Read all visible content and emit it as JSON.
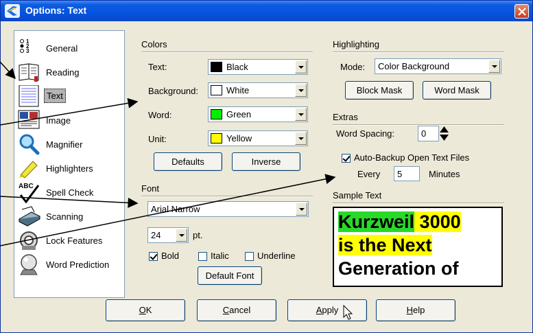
{
  "window": {
    "title": "Options: Text"
  },
  "categories": [
    {
      "label": "General",
      "icon": "general-list-icon"
    },
    {
      "label": "Reading",
      "icon": "reading-book-icon"
    },
    {
      "label": "Text",
      "icon": "text-page-icon",
      "selected": true
    },
    {
      "label": "Image",
      "icon": "image-icon"
    },
    {
      "label": "Magnifier",
      "icon": "magnifier-icon"
    },
    {
      "label": "Highlighters",
      "icon": "highlighter-icon"
    },
    {
      "label": "Spell Check",
      "icon": "spell-check-icon"
    },
    {
      "label": "Scanning",
      "icon": "scanner-icon"
    },
    {
      "label": "Lock Features",
      "icon": "lock-icon"
    },
    {
      "label": "Word Prediction",
      "icon": "crystal-ball-icon"
    }
  ],
  "colors": {
    "header": "Colors",
    "text_label": "Text:",
    "text_value": "Black",
    "text_swatch": "#000000",
    "background_label": "Background:",
    "background_value": "White",
    "background_swatch": "#ffffff",
    "word_label": "Word:",
    "word_value": "Green",
    "word_swatch": "#00ee00",
    "unit_label": "Unit:",
    "unit_value": "Yellow",
    "unit_swatch": "#ffff00",
    "defaults_button": "Defaults",
    "inverse_button": "Inverse"
  },
  "font": {
    "header": "Font",
    "family": "Arial Narrow",
    "size": "24",
    "size_unit": "pt.",
    "bold_label": "Bold",
    "bold_checked": true,
    "italic_label": "Italic",
    "italic_checked": false,
    "underline_label": "Underline",
    "underline_checked": false,
    "default_button": "Default Font"
  },
  "highlighting": {
    "header": "Highlighting",
    "mode_label": "Mode:",
    "mode_value": "Color Background",
    "block_mask_button": "Block Mask",
    "word_mask_button": "Word Mask"
  },
  "extras": {
    "header": "Extras",
    "word_spacing_label": "Word Spacing:",
    "word_spacing_value": "0",
    "autobackup_label": "Auto-Backup Open Text Files",
    "autobackup_checked": true,
    "every_label": "Every",
    "every_value": "5",
    "minutes_label": "Minutes"
  },
  "sample": {
    "header": "Sample Text",
    "line1_word1": "Kurzweil",
    "line1_word2": "3000",
    "line2": "is the Next",
    "line3": "Generation of"
  },
  "buttons": {
    "ok_prefix": "O",
    "ok_rest": "K",
    "cancel_prefix": "C",
    "cancel_rest": "ancel",
    "apply_prefix": "A",
    "apply_rest": "pply",
    "help_prefix": "H",
    "help_rest": "elp"
  }
}
